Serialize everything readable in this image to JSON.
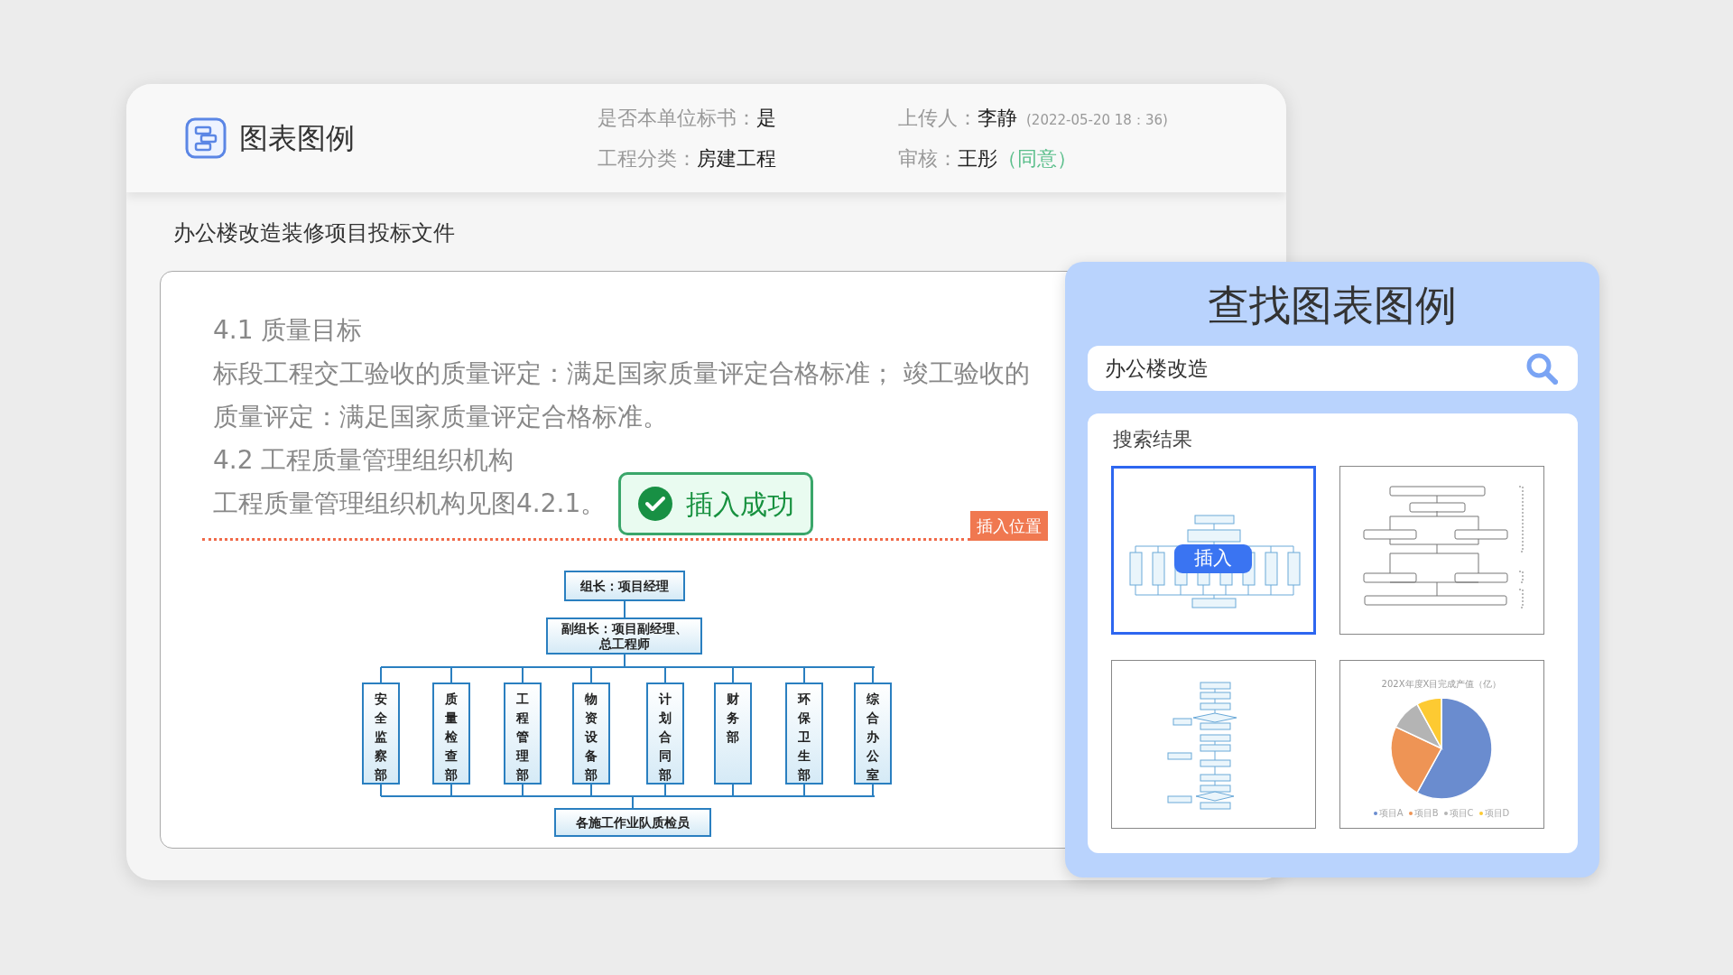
{
  "header": {
    "title": "图表图例",
    "meta": [
      {
        "label": "是否本单位标书：",
        "value": "是"
      },
      {
        "label": "上传人：",
        "value": "李静",
        "note": "(2022-05-20  18：36)"
      },
      {
        "label": "工程分类：",
        "value": "房建工程"
      },
      {
        "label": "审核：",
        "value": "王彤",
        "status": "（同意）"
      }
    ]
  },
  "document": {
    "title": "办公楼改造装修项目投标文件",
    "paragraphs": [
      "4.1 质量目标",
      "标段工程交工验收的质量评定：满足国家质量评定合格标准； 竣工验收的质量评定：满足国家质量评定合格标准。",
      "4.2 工程质量管理组织机构",
      "工程质量管理组织机构见图4.2.1。"
    ],
    "toast": {
      "text": "插入成功"
    },
    "insert_marker": {
      "label": "插入位置"
    },
    "org_chart": {
      "leader": "组长：项目经理",
      "deputy": "副组长：项目副经理、总工程师",
      "departments": [
        "安全监察部",
        "质量检查部",
        "工程管理部",
        "物资设备部",
        "计划合同部",
        "财务部",
        "环保卫生部",
        "综合办公室"
      ],
      "teams": "各施工作业队质检员"
    }
  },
  "search_panel": {
    "title": "查找图表图例",
    "search": {
      "value": "办公楼改造"
    },
    "results_title": "搜索结果",
    "insert_button": "插入",
    "results": [
      {
        "kind": "org_chart",
        "selected": true
      },
      {
        "kind": "tier_chart",
        "selected": false
      },
      {
        "kind": "flow_chart",
        "selected": false
      },
      {
        "kind": "pie_chart",
        "selected": false,
        "title": "202X年度X目完成产值（亿）",
        "legend": [
          {
            "label": "项目A",
            "color": "#6a8ccf"
          },
          {
            "label": "项目B",
            "color": "#ee9455"
          },
          {
            "label": "项目C",
            "color": "#b4b4b4"
          },
          {
            "label": "项目D",
            "color": "#fdca32"
          }
        ]
      }
    ]
  }
}
